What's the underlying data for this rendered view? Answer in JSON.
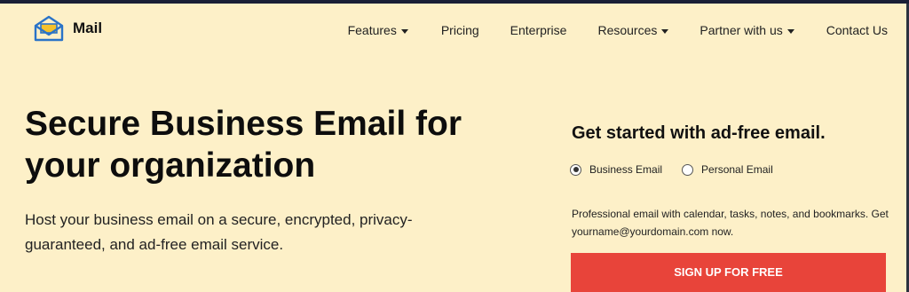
{
  "header": {
    "logo_text": "Mail",
    "nav": [
      {
        "label": "Features",
        "dropdown": true
      },
      {
        "label": "Pricing",
        "dropdown": false
      },
      {
        "label": "Enterprise",
        "dropdown": false
      },
      {
        "label": "Resources",
        "dropdown": true
      },
      {
        "label": "Partner with us",
        "dropdown": true
      },
      {
        "label": "Contact Us",
        "dropdown": false
      }
    ]
  },
  "hero": {
    "headline": "Secure Business Email for your organization",
    "subtext": "Host your business email on a secure, encrypted, privacy-guaranteed, and ad-free email service."
  },
  "signup_panel": {
    "title": "Get started with ad-free email.",
    "options": [
      {
        "label": "Business Email",
        "selected": true
      },
      {
        "label": "Personal Email",
        "selected": false
      }
    ],
    "description": "Professional email with calendar, tasks, notes, and bookmarks. Get yourname@yourdomain.com now.",
    "button_label": "SIGN UP FOR FREE"
  },
  "colors": {
    "background": "#fdf0c8",
    "cta": "#e8443a",
    "logo_blue": "#2a73c8",
    "logo_yellow": "#f5c12a"
  },
  "icons": [
    "mail-envelope-logo-icon",
    "caret-down-icon",
    "radio-selected-icon",
    "radio-unselected-icon"
  ]
}
